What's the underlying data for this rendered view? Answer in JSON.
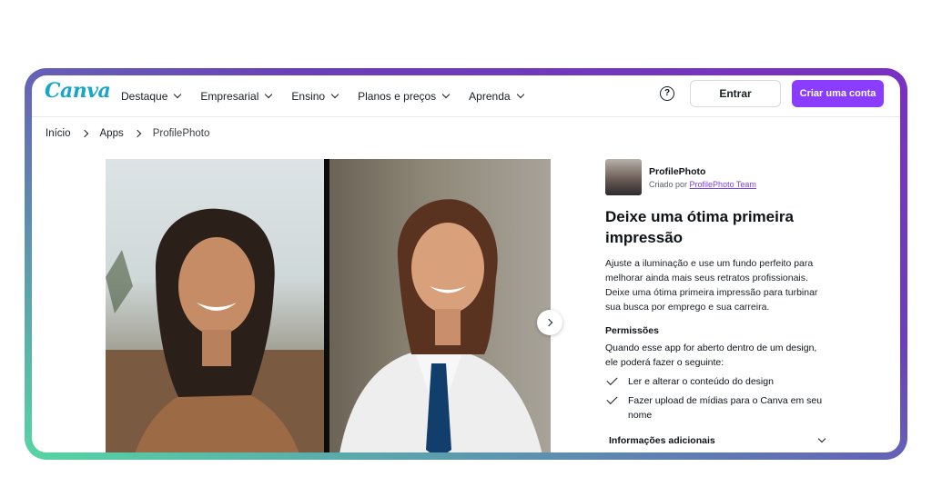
{
  "nav": {
    "logo": "Canva",
    "menu": [
      "Destaque",
      "Empresarial",
      "Ensino",
      "Planos e preços",
      "Aprenda"
    ],
    "help": "?",
    "login": "Entrar",
    "signup": "Criar uma conta"
  },
  "breadcrumb": [
    "Início",
    "Apps",
    "ProfilePhoto"
  ],
  "app": {
    "name": "ProfilePhoto",
    "by_prefix": "Criado por",
    "by_link": "ProfilePhoto Team",
    "title": "Deixe uma ótima primeira impressão",
    "description": "Ajuste a iluminação e use um fundo perfeito para melhorar ainda mais seus retratos profissionais. Deixe uma ótima primeira impressão para turbinar sua busca por emprego e sua carreira.",
    "permissions_heading": "Permissões",
    "permissions_intro": "Quando esse app for aberto dentro de um design, ele poderá fazer o seguinte:",
    "permissions": [
      "Ler e alterar o conteúdo do design",
      "Fazer upload de mídias para o Canva em seu nome"
    ],
    "more_info": "Informações adicionais"
  },
  "colors": {
    "brand": "#8b3dff",
    "logo": "#19a6c7"
  },
  "icons": {
    "help": "question-circle-icon",
    "next": "chevron-right-icon",
    "check": "check-icon"
  }
}
